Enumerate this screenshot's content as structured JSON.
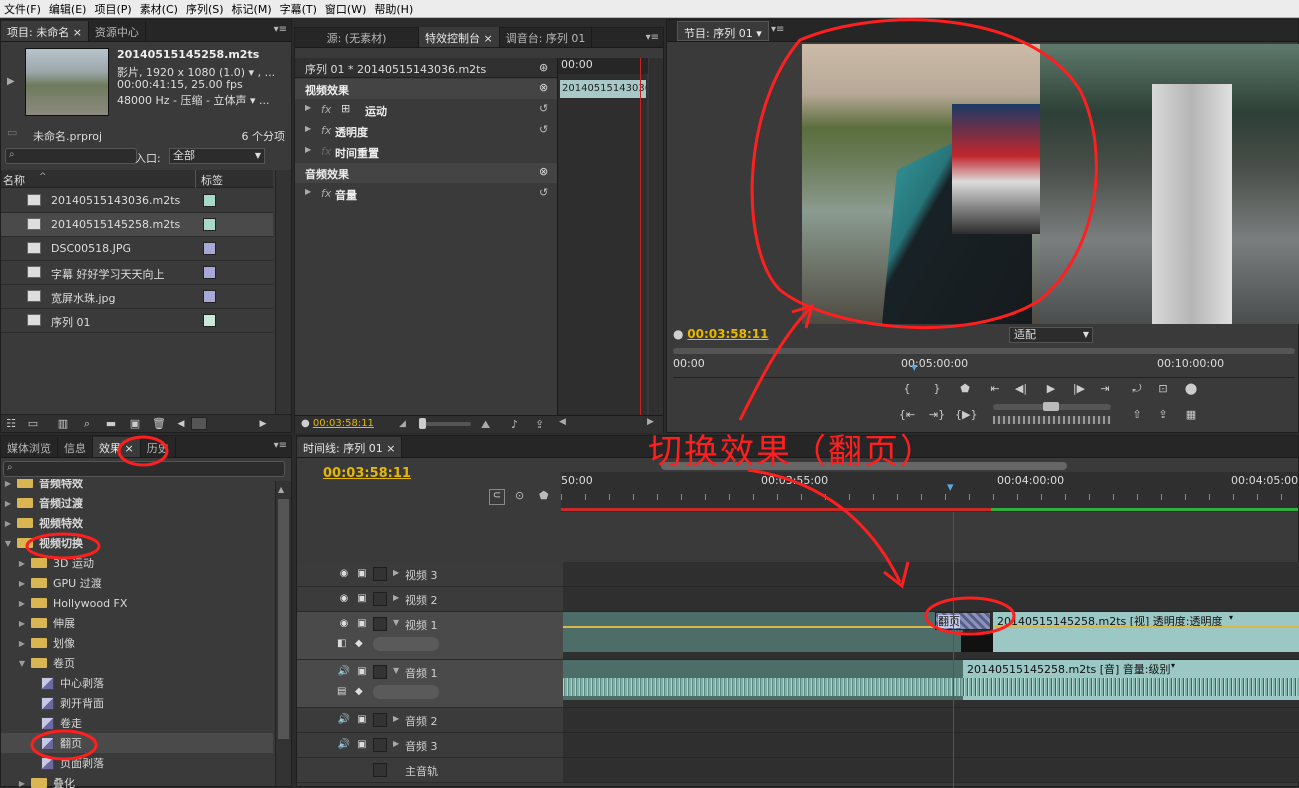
{
  "menu": [
    "文件(F)",
    "编辑(E)",
    "项目(P)",
    "素材(C)",
    "序列(S)",
    "标记(M)",
    "字幕(T)",
    "窗口(W)",
    "帮助(H)"
  ],
  "project": {
    "tabs": [
      "项目: 未命名",
      "资源中心"
    ],
    "clip_name": "20140515145258.m2ts",
    "clip_info1": "影片, 1920 x 1080 (1.0)",
    "clip_info2": "00:00:41:15, 25.00 fps",
    "clip_info3": "48000 Hz - 压缩 - 立体声",
    "proj_file": "未命名.prproj",
    "count": "6 个分项",
    "entry_label": "入口:",
    "entry_value": "全部",
    "col_name": "名称",
    "col_label": "标签",
    "items": [
      {
        "name": "20140515143036.m2ts",
        "color": "#a8d8c8",
        "icon": "video-audio-icon"
      },
      {
        "name": "20140515145258.m2ts",
        "color": "#a8d8c8",
        "icon": "video-audio-icon"
      },
      {
        "name": "DSC00518.JPG",
        "color": "#a8a8d8",
        "icon": "image-file-icon"
      },
      {
        "name": "字幕 好好学习天天向上",
        "color": "#a8a8d8",
        "icon": "title-icon"
      },
      {
        "name": "宽屏水珠.jpg",
        "color": "#a8a8d8",
        "icon": "image-file-icon"
      },
      {
        "name": "序列 01",
        "color": "#c8e8d8",
        "icon": "sequence-icon"
      }
    ]
  },
  "effect_controls": {
    "tabs": [
      "源: (无素材)",
      "特效控制台",
      "调音台: 序列 01"
    ],
    "header": "序列 01 * 20140515143036.m2ts",
    "ruler_tc": "00:00",
    "clip_tc": "20140515143036",
    "video_effects": "视频效果",
    "motion": "运动",
    "opacity": "透明度",
    "time_remap": "时间重置",
    "audio_effects": "音频效果",
    "volume": "音量",
    "fx": "fx",
    "bottom_tc": "00:03:58:11"
  },
  "program": {
    "tab": "节目: 序列 01",
    "timecode": "00:03:58:11",
    "fit": "适配",
    "ruler": [
      "00:00",
      "00:05:00:00",
      "00:10:00:00"
    ],
    "playhead_fraction": 0.383
  },
  "effects": {
    "tabs": [
      "媒体浏览",
      "信息",
      "效果",
      "历史"
    ],
    "folders": [
      {
        "label": "音频特效",
        "level": 0,
        "open": false
      },
      {
        "label": "音频过渡",
        "level": 0,
        "open": false
      },
      {
        "label": "视频特效",
        "level": 0,
        "open": false
      },
      {
        "label": "视频切换",
        "level": 0,
        "open": true
      },
      {
        "label": "3D 运动",
        "level": 1,
        "open": false
      },
      {
        "label": "GPU 过渡",
        "level": 1,
        "open": false
      },
      {
        "label": "Hollywood FX",
        "level": 1,
        "open": false
      },
      {
        "label": "伸展",
        "level": 1,
        "open": false
      },
      {
        "label": "划像",
        "level": 1,
        "open": false
      },
      {
        "label": "卷页",
        "level": 1,
        "open": true
      }
    ],
    "page_items": [
      "中心剥落",
      "剥开背面",
      "卷走",
      "翻页",
      "页面剥落"
    ],
    "last": "叠化"
  },
  "timeline": {
    "tab": "时间线: 序列 01",
    "timecode": "00:03:58:11",
    "ruler": [
      "50:00",
      "00:03:55:00",
      "00:04:00:00",
      "00:04:05:00"
    ],
    "tracks": {
      "v3": "视频 3",
      "v2": "视频 2",
      "v1": "视频 1",
      "a1": "音频 1",
      "a2": "音频 2",
      "a3": "音频 3",
      "master": "主音轨"
    },
    "transition": "翻页",
    "clip_video": "20140515145258.m2ts [视] 透明度:透明度",
    "clip_audio": "20140515145258.m2ts [音] 音量:级别"
  },
  "annotation": "切换效果（翻页）",
  "accent": "#e6b800",
  "annotation_color": "#ff1f1f"
}
